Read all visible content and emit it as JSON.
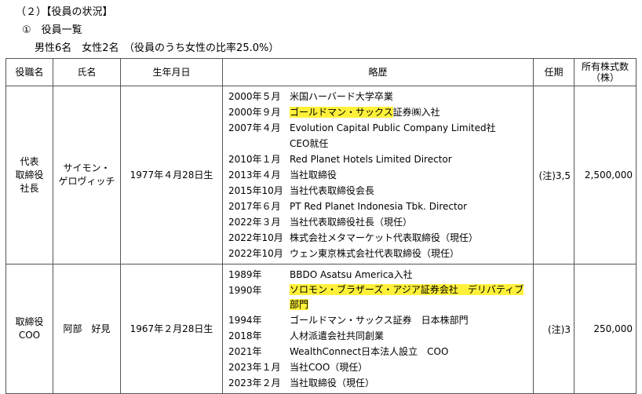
{
  "heading": {
    "section": "（２）【役員の状況】",
    "subsection": "①　役員一覧",
    "gender_summary": "男性6名　女性2名　（役員のうち女性の比率25.0%）"
  },
  "table": {
    "headers": {
      "position": "役職名",
      "name": "氏名",
      "birthdate": "生年月日",
      "history": "略歴",
      "term": "任期",
      "shares": "所有株式数（株）"
    },
    "rows": [
      {
        "position": "代表\n取締役\n社長",
        "name": "サイモン・\nゲロヴィッチ",
        "birthdate": "1977年４月28日生",
        "term": "(注)3,5",
        "shares": "2,500,000",
        "history": [
          {
            "date": "2000年５月",
            "desc": "米国ハーバード大学卒業"
          },
          {
            "date": "2000年９月",
            "desc": "ゴールドマン・サックス証券㈱入社",
            "highlight": "ゴールドマン・サックス"
          },
          {
            "date": "2007年４月",
            "desc": "Evolution Capital Public Company Limited社"
          },
          {
            "date": "",
            "desc": "CEO就任"
          },
          {
            "date": "2010年１月",
            "desc": "Red Planet Hotels Limited Director"
          },
          {
            "date": "2013年４月",
            "desc": "当社取締役"
          },
          {
            "date": "2015年10月",
            "desc": "当社代表取締役会長"
          },
          {
            "date": "2017年６月",
            "desc": "PT Red Planet Indonesia Tbk. Director"
          },
          {
            "date": "2022年３月",
            "desc": "当社代表取締役社長（現任）"
          },
          {
            "date": "2022年10月",
            "desc": "株式会社メタマーケット代表取締役（現任）"
          },
          {
            "date": "2022年10月",
            "desc": "ウェン東京株式会社代表取締役（現任）"
          }
        ]
      },
      {
        "position": "取締役\nCOO",
        "name": "阿部　好見",
        "birthdate": "1967年２月28日生",
        "term": "(注)3",
        "shares": "250,000",
        "history": [
          {
            "date": "1989年",
            "desc": "BBDO Asatsu America入社"
          },
          {
            "date": "1990年",
            "desc": "ソロモン・ブラザーズ・アジア証券会社　デリバティブ部門",
            "highlight": "ソロモン・ブラザーズ・アジア証券会社　デリバティブ部門",
            "wrap": true
          },
          {
            "date": "1994年",
            "desc": "ゴールドマン・サックス証券　日本株部門"
          },
          {
            "date": "2018年",
            "desc": "人材派遣会社共同創業"
          },
          {
            "date": "2021年",
            "desc": "WealthConnect日本法人設立　COO"
          },
          {
            "date": "2023年１月",
            "desc": "当社COO（現任）"
          },
          {
            "date": "2023年２月",
            "desc": "当社取締役（現任）"
          }
        ]
      }
    ]
  },
  "colors": {
    "highlight": "#fff13a",
    "border": "#555555"
  }
}
